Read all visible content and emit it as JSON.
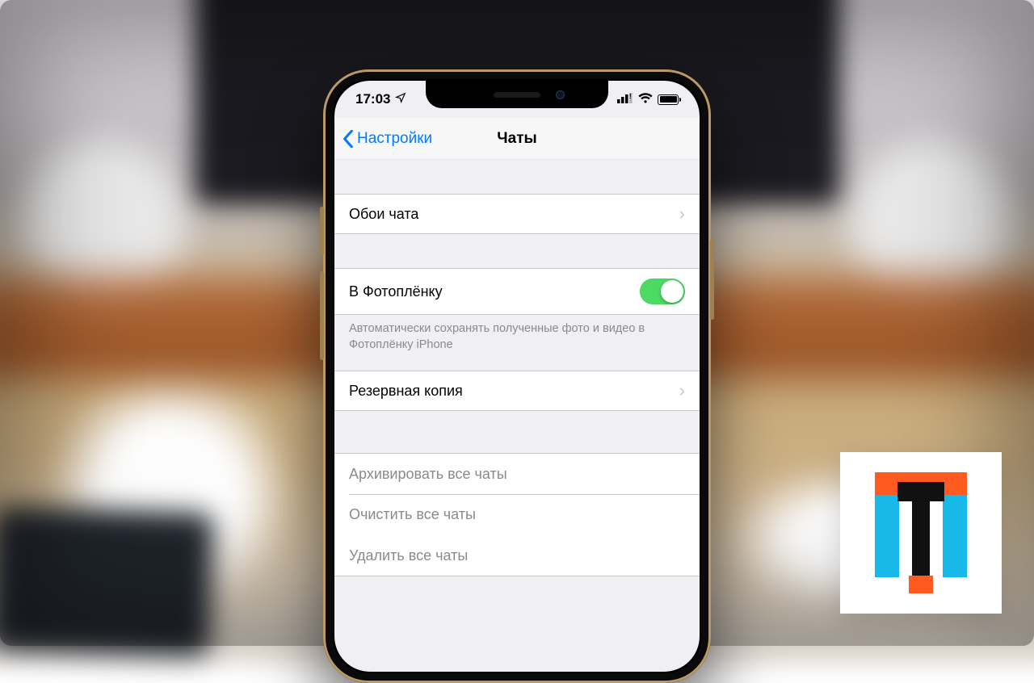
{
  "status": {
    "time": "17:03"
  },
  "nav": {
    "back": "Настройки",
    "title": "Чаты"
  },
  "rows": {
    "wallpaper": "Обои чата",
    "save_to_roll": "В Фотоплёнку",
    "save_to_roll_on": true,
    "save_footer": "Автоматически сохранять полученные фото и видео в Фотоплёнку iPhone",
    "backup": "Резервная копия",
    "archive_all": "Архивировать все чаты",
    "clear_all": "Очистить все чаты",
    "delete_all": "Удалить все чаты"
  }
}
